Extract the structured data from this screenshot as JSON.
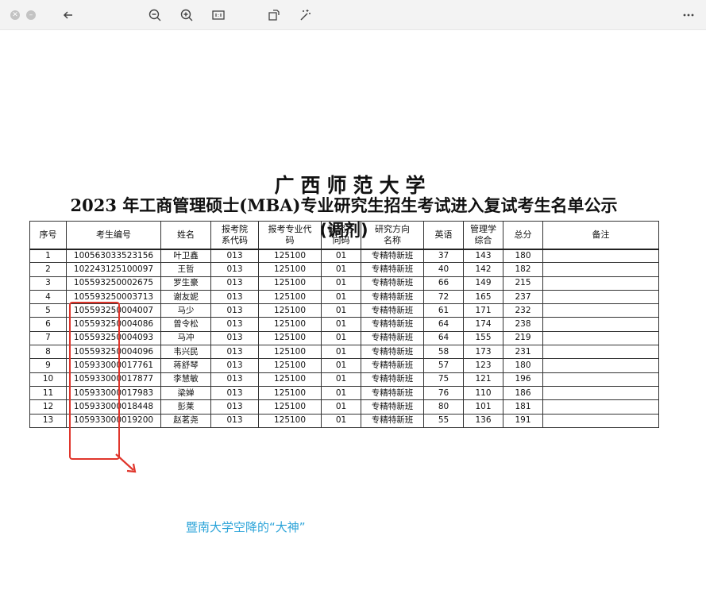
{
  "toolbar": {
    "icons": [
      "close-icon",
      "minimize-icon",
      "back-arrow-icon",
      "zoom-out-icon",
      "zoom-in-icon",
      "actual-size-icon",
      "rotate-icon",
      "magic-wand-icon",
      "more-icon"
    ]
  },
  "document": {
    "title_line1": "广西师范大学",
    "title_line2": "2023 年工商管理硕士(MBA)专业研究生招生考试进入复试考生名单公示",
    "title_line3": "(调剂)",
    "columns": [
      "序号",
      "考生编号",
      "姓名",
      "报考院系代码",
      "报考专业代码",
      "研究方向码",
      "研究方向名称",
      "英语",
      "管理学综合",
      "总分",
      "备注"
    ],
    "column_display": [
      "序号",
      "考生编号",
      "姓名",
      "报考院\n系代码",
      "报考专业代\n码",
      "研究方\n向码",
      "研究方向\n名称",
      "英语",
      "管理学\n综合",
      "总分",
      "备注"
    ],
    "rows": [
      [
        "1",
        "100563033523156",
        "叶卫鑫",
        "013",
        "125100",
        "01",
        "专精特新班",
        "37",
        "143",
        "180",
        ""
      ],
      [
        "2",
        "102243125100097",
        "王哲",
        "013",
        "125100",
        "01",
        "专精特新班",
        "40",
        "142",
        "182",
        ""
      ],
      [
        "3",
        "105593250002675",
        "罗生豪",
        "013",
        "125100",
        "01",
        "专精特新班",
        "66",
        "149",
        "215",
        ""
      ],
      [
        "4",
        "105593250003713",
        "谢友妮",
        "013",
        "125100",
        "01",
        "专精特新班",
        "72",
        "165",
        "237",
        ""
      ],
      [
        "5",
        "105593250004007",
        "马少",
        "013",
        "125100",
        "01",
        "专精特新班",
        "61",
        "171",
        "232",
        ""
      ],
      [
        "6",
        "105593250004086",
        "曾令松",
        "013",
        "125100",
        "01",
        "专精特新班",
        "64",
        "174",
        "238",
        ""
      ],
      [
        "7",
        "105593250004093",
        "马冲",
        "013",
        "125100",
        "01",
        "专精特新班",
        "64",
        "155",
        "219",
        ""
      ],
      [
        "8",
        "105593250004096",
        "韦兴民",
        "013",
        "125100",
        "01",
        "专精特新班",
        "58",
        "173",
        "231",
        ""
      ],
      [
        "9",
        "105933000017761",
        "蒋舒琴",
        "013",
        "125100",
        "01",
        "专精特新班",
        "57",
        "123",
        "180",
        ""
      ],
      [
        "10",
        "105933000017877",
        "李慧敏",
        "013",
        "125100",
        "01",
        "专精特新班",
        "75",
        "121",
        "196",
        ""
      ],
      [
        "11",
        "105933000017983",
        "梁婵",
        "013",
        "125100",
        "01",
        "专精特新班",
        "76",
        "110",
        "186",
        ""
      ],
      [
        "12",
        "105933000018448",
        "彭莱",
        "013",
        "125100",
        "01",
        "专精特新班",
        "80",
        "101",
        "181",
        ""
      ],
      [
        "13",
        "105933000019200",
        "赵茗尧",
        "013",
        "125100",
        "01",
        "专精特新班",
        "55",
        "136",
        "191",
        ""
      ]
    ]
  },
  "annotation": {
    "caption": "暨南大学空降的“大神”",
    "highlight_color": "#e0362c",
    "caption_color": "#2aa3d8"
  }
}
